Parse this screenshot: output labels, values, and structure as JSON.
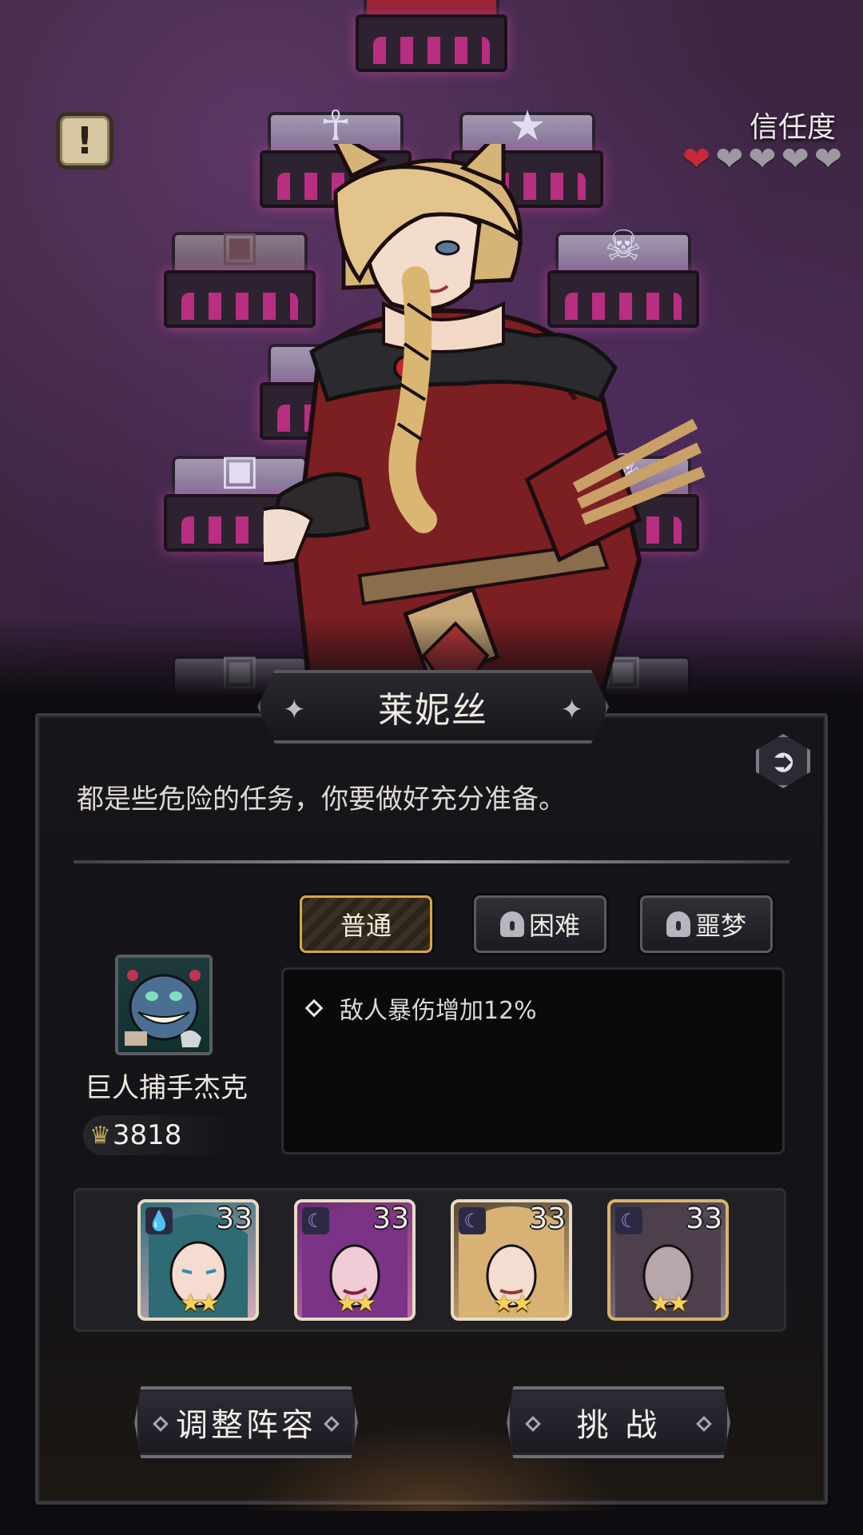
{
  "header": {
    "trust_label": "信任度",
    "trust_level": 1,
    "trust_max": 5,
    "heart_glyph": "❤"
  },
  "npc": {
    "name": "莱妮丝",
    "dialogue": "都是些危险的任务，你要做好充分准备。"
  },
  "difficulty": {
    "tabs": [
      {
        "label": "普通",
        "locked": false,
        "active": true
      },
      {
        "label": "困难",
        "locked": true,
        "active": false
      },
      {
        "label": "噩梦",
        "locked": true,
        "active": false
      }
    ]
  },
  "boss": {
    "name": "巨人捕手杰克",
    "power": "3818"
  },
  "buffs": [
    "敌人暴伤增加12%"
  ],
  "team": [
    {
      "level": "33",
      "stars": "★★",
      "element": "water"
    },
    {
      "level": "33",
      "stars": "★★",
      "element": "moon"
    },
    {
      "level": "33",
      "stars": "★★",
      "element": "moon"
    },
    {
      "level": "33",
      "stars": "★★",
      "element": "moon"
    }
  ],
  "actions": {
    "adjust_lineup": "调整阵容",
    "challenge": "挑 战"
  },
  "colors": {
    "heart_active": "#c8283a",
    "heart_inactive": "#9c9aa0",
    "tab_active_border": "#d9a743",
    "star": "#f5d25c"
  },
  "icons": {
    "alert": "!",
    "share": "➲",
    "crown": "♛",
    "water_element": "💧",
    "moon_element": "☾"
  }
}
